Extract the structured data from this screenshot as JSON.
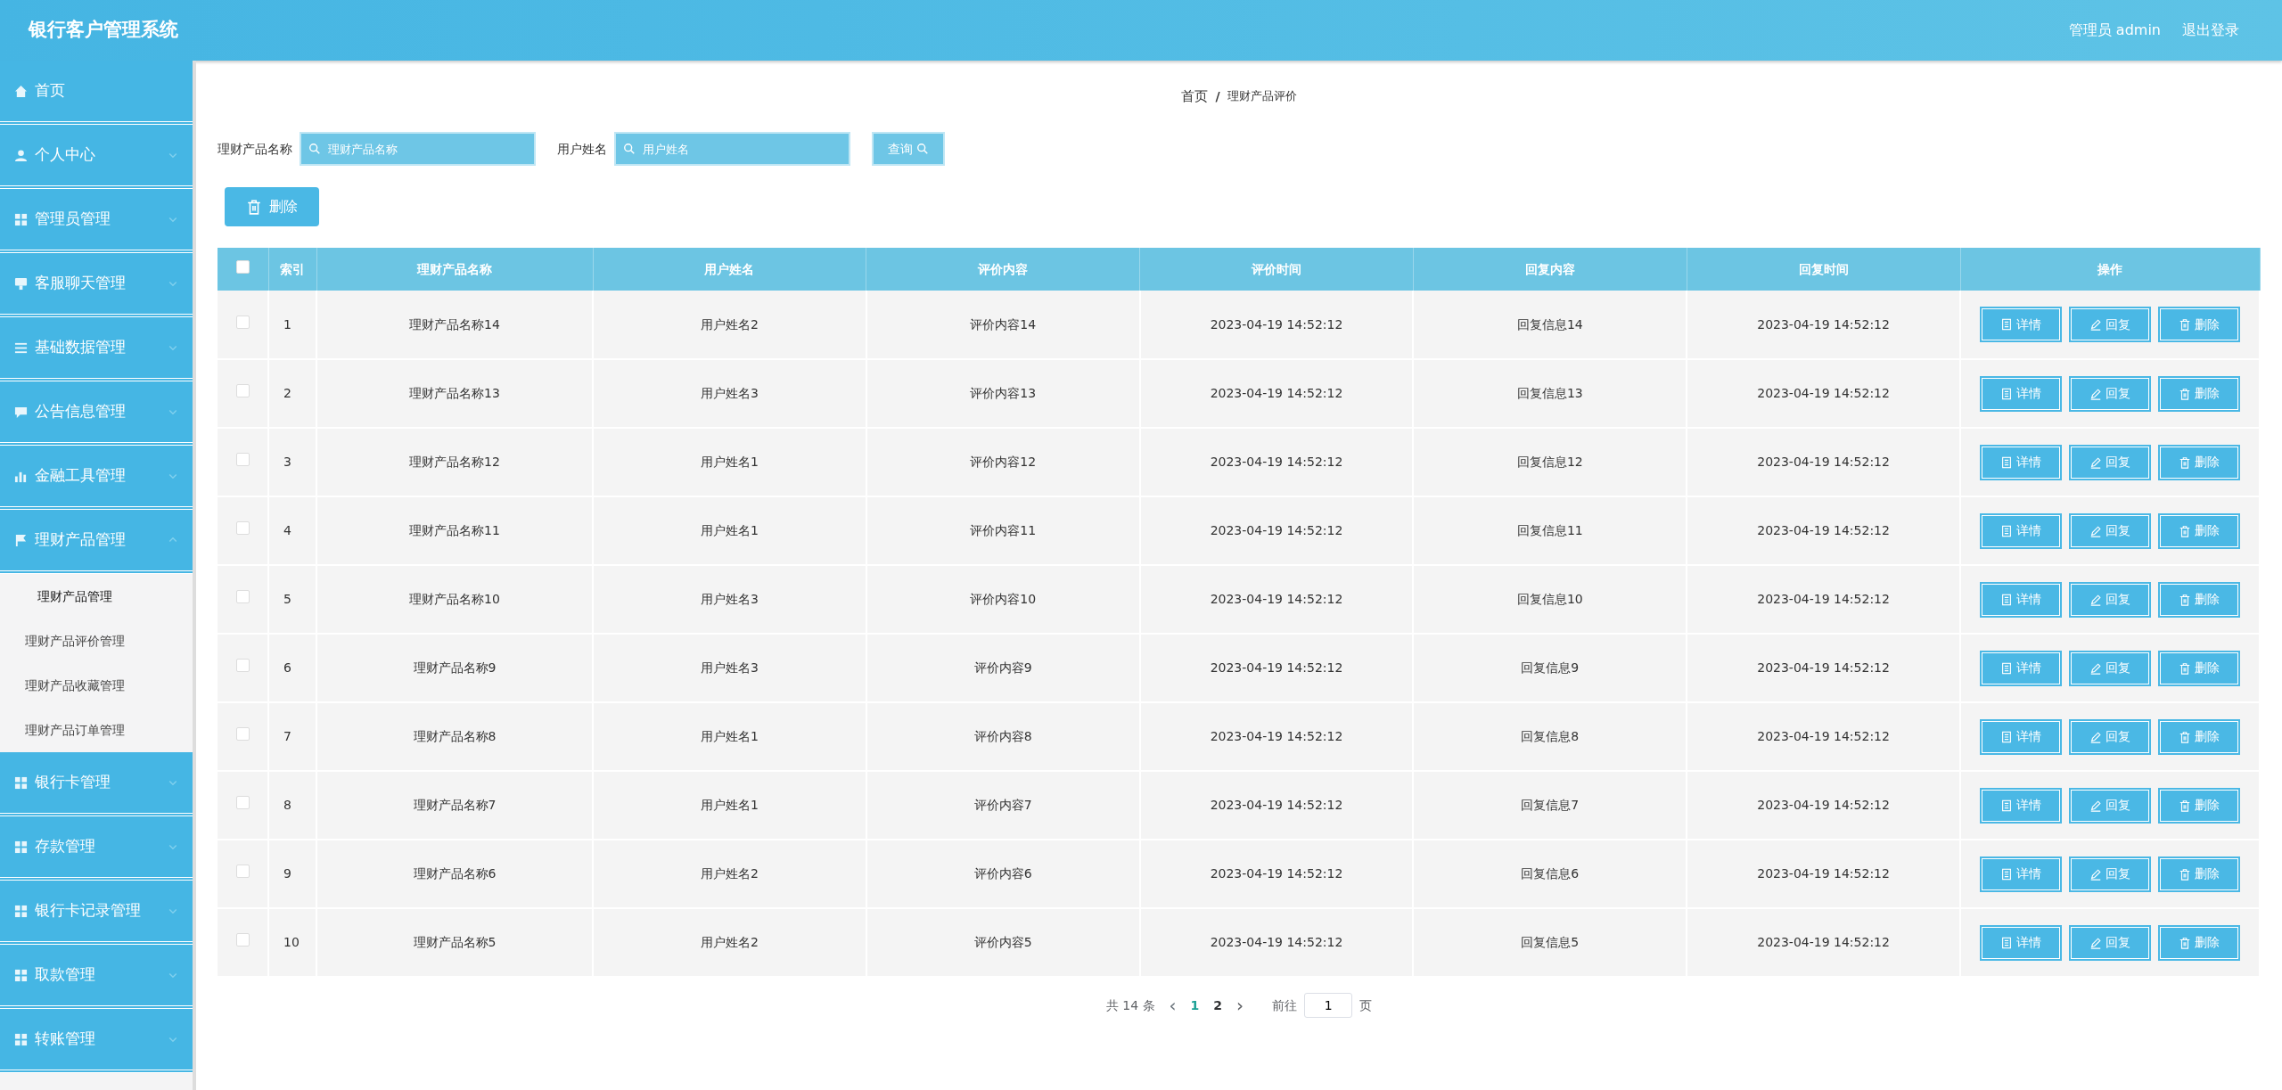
{
  "header": {
    "title": "银行客户管理系统",
    "user": "管理员 admin",
    "logout": "退出登录"
  },
  "sidebar": {
    "items": [
      {
        "label": "首页",
        "kind": "home"
      },
      {
        "label": "个人中心",
        "kind": "person",
        "expanded": false
      },
      {
        "label": "管理员管理",
        "kind": "grid",
        "expanded": false
      },
      {
        "label": "客服聊天管理",
        "kind": "monitor",
        "expanded": false
      },
      {
        "label": "基础数据管理",
        "kind": "list",
        "expanded": false
      },
      {
        "label": "公告信息管理",
        "kind": "chat",
        "expanded": false
      },
      {
        "label": "金融工具管理",
        "kind": "chart",
        "expanded": false
      },
      {
        "label": "理财产品管理",
        "kind": "flag",
        "expanded": true,
        "children": [
          {
            "label": "理财产品管理",
            "selected": true
          },
          {
            "label": "理财产品评价管理",
            "selected": false
          },
          {
            "label": "理财产品收藏管理",
            "selected": false
          },
          {
            "label": "理财产品订单管理",
            "selected": false
          }
        ]
      },
      {
        "label": "银行卡管理",
        "kind": "grid",
        "expanded": false
      },
      {
        "label": "存款管理",
        "kind": "grid",
        "expanded": false
      },
      {
        "label": "银行卡记录管理",
        "kind": "grid",
        "expanded": false
      },
      {
        "label": "取款管理",
        "kind": "grid",
        "expanded": false
      },
      {
        "label": "转账管理",
        "kind": "grid",
        "expanded": false
      }
    ]
  },
  "breadcrumb": {
    "items": [
      "首页",
      "理财产品评价"
    ],
    "separator": "/"
  },
  "search": {
    "fields": [
      {
        "label": "理财产品名称",
        "placeholder": "理财产品名称"
      },
      {
        "label": "用户姓名",
        "placeholder": "用户姓名"
      }
    ],
    "button": "查询"
  },
  "delete_button": "删除",
  "table": {
    "select_all_checked": false,
    "columns": [
      "索引",
      "理财产品名称",
      "用户姓名",
      "评价内容",
      "评价时间",
      "回复内容",
      "回复时间",
      "操作"
    ],
    "rows": [
      {
        "checked": false,
        "cells": [
          "1",
          "理财产品名称14",
          "用户姓名2",
          "评价内容14",
          "2023-04-19 14:52:12",
          "回复信息14",
          "2023-04-19 14:52:12"
        ],
        "actions": [
          {
            "kind": "detail",
            "label": "详情"
          },
          {
            "kind": "reply",
            "label": "回复"
          },
          {
            "kind": "delete",
            "label": "删除"
          }
        ]
      },
      {
        "checked": false,
        "cells": [
          "2",
          "理财产品名称13",
          "用户姓名3",
          "评价内容13",
          "2023-04-19 14:52:12",
          "回复信息13",
          "2023-04-19 14:52:12"
        ],
        "actions": [
          {
            "kind": "detail",
            "label": "详情"
          },
          {
            "kind": "reply",
            "label": "回复"
          },
          {
            "kind": "delete",
            "label": "删除"
          }
        ]
      },
      {
        "checked": false,
        "cells": [
          "3",
          "理财产品名称12",
          "用户姓名1",
          "评价内容12",
          "2023-04-19 14:52:12",
          "回复信息12",
          "2023-04-19 14:52:12"
        ],
        "actions": [
          {
            "kind": "detail",
            "label": "详情"
          },
          {
            "kind": "reply",
            "label": "回复"
          },
          {
            "kind": "delete",
            "label": "删除"
          }
        ]
      },
      {
        "checked": false,
        "cells": [
          "4",
          "理财产品名称11",
          "用户姓名1",
          "评价内容11",
          "2023-04-19 14:52:12",
          "回复信息11",
          "2023-04-19 14:52:12"
        ],
        "actions": [
          {
            "kind": "detail",
            "label": "详情"
          },
          {
            "kind": "reply",
            "label": "回复"
          },
          {
            "kind": "delete",
            "label": "删除"
          }
        ]
      },
      {
        "checked": false,
        "cells": [
          "5",
          "理财产品名称10",
          "用户姓名3",
          "评价内容10",
          "2023-04-19 14:52:12",
          "回复信息10",
          "2023-04-19 14:52:12"
        ],
        "actions": [
          {
            "kind": "detail",
            "label": "详情"
          },
          {
            "kind": "reply",
            "label": "回复"
          },
          {
            "kind": "delete",
            "label": "删除"
          }
        ]
      },
      {
        "checked": false,
        "cells": [
          "6",
          "理财产品名称9",
          "用户姓名3",
          "评价内容9",
          "2023-04-19 14:52:12",
          "回复信息9",
          "2023-04-19 14:52:12"
        ],
        "actions": [
          {
            "kind": "detail",
            "label": "详情"
          },
          {
            "kind": "reply",
            "label": "回复"
          },
          {
            "kind": "delete",
            "label": "删除"
          }
        ]
      },
      {
        "checked": false,
        "cells": [
          "7",
          "理财产品名称8",
          "用户姓名1",
          "评价内容8",
          "2023-04-19 14:52:12",
          "回复信息8",
          "2023-04-19 14:52:12"
        ],
        "actions": [
          {
            "kind": "detail",
            "label": "详情"
          },
          {
            "kind": "reply",
            "label": "回复"
          },
          {
            "kind": "delete",
            "label": "删除"
          }
        ]
      },
      {
        "checked": false,
        "cells": [
          "8",
          "理财产品名称7",
          "用户姓名1",
          "评价内容7",
          "2023-04-19 14:52:12",
          "回复信息7",
          "2023-04-19 14:52:12"
        ],
        "actions": [
          {
            "kind": "detail",
            "label": "详情"
          },
          {
            "kind": "reply",
            "label": "回复"
          },
          {
            "kind": "delete",
            "label": "删除"
          }
        ]
      },
      {
        "checked": false,
        "cells": [
          "9",
          "理财产品名称6",
          "用户姓名2",
          "评价内容6",
          "2023-04-19 14:52:12",
          "回复信息6",
          "2023-04-19 14:52:12"
        ],
        "actions": [
          {
            "kind": "detail",
            "label": "详情"
          },
          {
            "kind": "reply",
            "label": "回复"
          },
          {
            "kind": "delete",
            "label": "删除"
          }
        ]
      },
      {
        "checked": false,
        "cells": [
          "10",
          "理财产品名称5",
          "用户姓名2",
          "评价内容5",
          "2023-04-19 14:52:12",
          "回复信息5",
          "2023-04-19 14:52:12"
        ],
        "actions": [
          {
            "kind": "detail",
            "label": "详情"
          },
          {
            "kind": "reply",
            "label": "回复"
          },
          {
            "kind": "delete",
            "label": "删除"
          }
        ]
      }
    ]
  },
  "pagination": {
    "total": "共 14 条",
    "prev": "‹",
    "pages": [
      {
        "label": "1",
        "selected": true
      },
      {
        "label": "2",
        "selected": false
      }
    ],
    "next": "›",
    "goto_label": "前往",
    "goto_value": "1",
    "goto_suffix": "页"
  }
}
